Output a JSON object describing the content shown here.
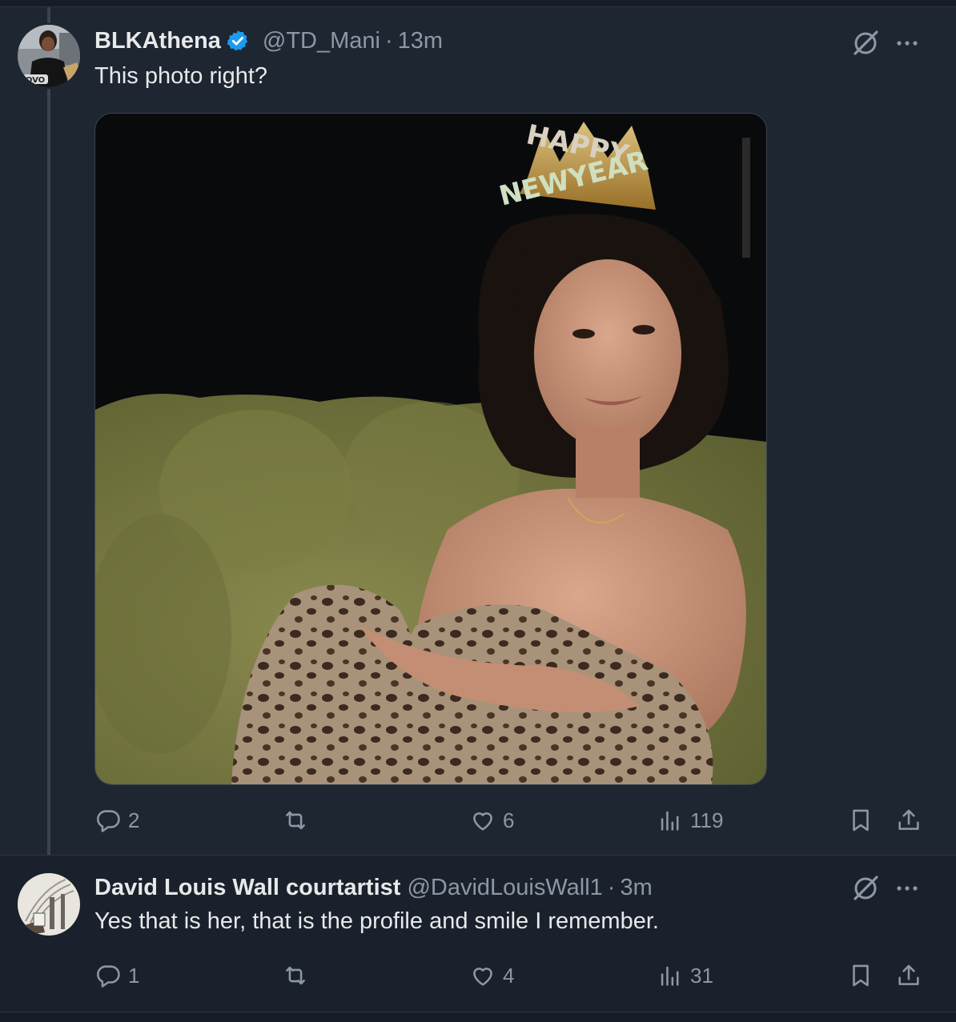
{
  "tweet1": {
    "name": "BLKAthena",
    "handle": "@TD_Mani",
    "separator": "·",
    "time": "13m",
    "text": "This photo right?",
    "media": {
      "crown_line1": "HAPPY",
      "crown_line2": "NEWYEAR"
    },
    "avatar_shirt_text": "OVO",
    "stats": {
      "replies": "2",
      "retweets": "",
      "likes": "6",
      "views": "119"
    }
  },
  "tweet2": {
    "name": "David Louis Wall courtartist",
    "handle": "@DavidLouisWall1",
    "separator": "·",
    "time": "3m",
    "text": "Yes that is her, that is the profile and smile I remember.",
    "stats": {
      "replies": "1",
      "retweets": "",
      "likes": "4",
      "views": "31"
    }
  },
  "icons": [
    "verified-badge-icon",
    "grok-icon",
    "more-icon",
    "reply-icon",
    "retweet-icon",
    "like-icon",
    "views-icon",
    "bookmark-icon",
    "share-icon"
  ],
  "colors": {
    "background": "#1e2632",
    "text": "#e7e9ea",
    "muted": "#8b98a5",
    "verified": "#1d9bf0"
  }
}
